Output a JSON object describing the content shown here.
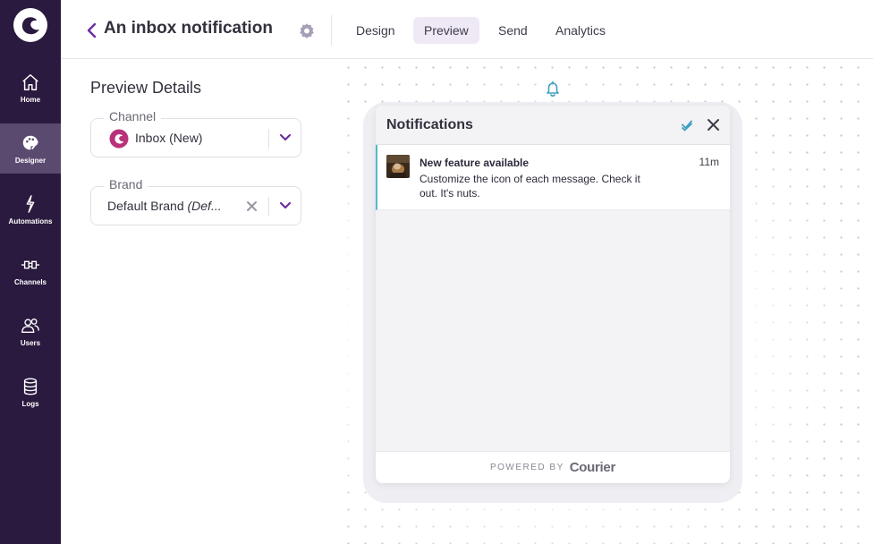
{
  "sidebar": {
    "items": [
      {
        "label": "Home",
        "icon": "home-icon"
      },
      {
        "label": "Designer",
        "icon": "palette-icon"
      },
      {
        "label": "Automations",
        "icon": "lightning-icon"
      },
      {
        "label": "Channels",
        "icon": "plug-icon"
      },
      {
        "label": "Users",
        "icon": "users-icon"
      },
      {
        "label": "Logs",
        "icon": "database-icon"
      }
    ],
    "active": "Designer"
  },
  "header": {
    "title": "An inbox notification",
    "tabs": [
      "Design",
      "Preview",
      "Send",
      "Analytics"
    ],
    "active_tab": "Preview"
  },
  "preview": {
    "title": "Preview Details",
    "channel": {
      "label": "Channel",
      "value": "Inbox (New)"
    },
    "brand": {
      "label": "Brand",
      "value": "Default Brand",
      "value_suffix": "(Def..."
    }
  },
  "inbox": {
    "title": "Notifications",
    "messages": [
      {
        "title": "New feature available",
        "body": "Customize the icon of each message. Check it out. It's nuts.",
        "time": "11m"
      }
    ],
    "footer": {
      "powered_by": "POWERED BY",
      "brand": "Courier"
    }
  },
  "colors": {
    "sidebar_bg": "#2a1a3f",
    "sidebar_active": "#5b4a70",
    "accent": "#6b2fa0",
    "unread_bar": "#52b9cb",
    "bell": "#3fa0c0"
  }
}
